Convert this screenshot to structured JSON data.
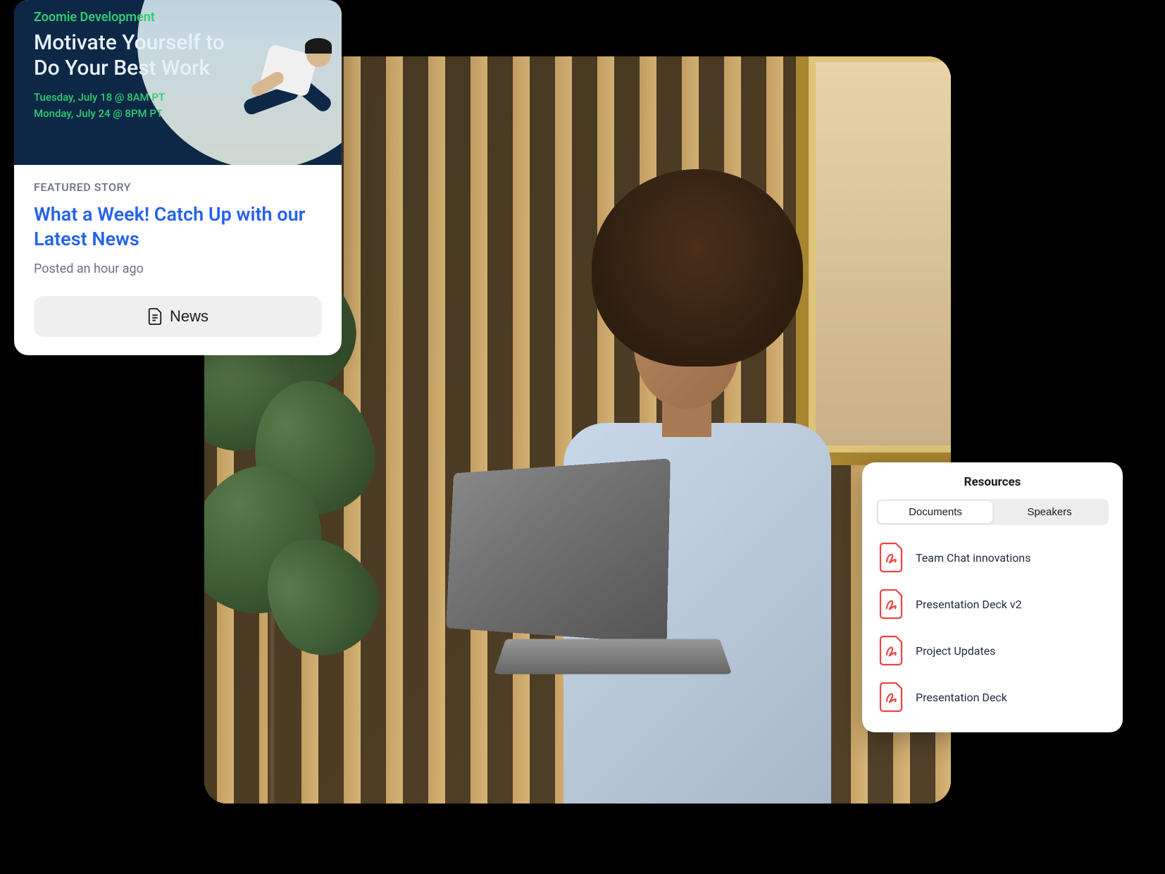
{
  "storyCard": {
    "brand": "Zoomie Development",
    "heroTitle": "Motivate Yourself to Do Your Best Work",
    "dates": [
      "Tuesday, July 18 @ 8AM PT",
      "Monday, July 24 @ 8PM PT"
    ],
    "featuredLabel": "FEATURED STORY",
    "headline": "What a Week! Catch Up with our Latest News",
    "posted": "Posted an hour ago",
    "newsButtonLabel": "News"
  },
  "resources": {
    "title": "Resources",
    "tabs": [
      {
        "label": "Documents",
        "active": true
      },
      {
        "label": "Speakers",
        "active": false
      }
    ],
    "items": [
      {
        "name": "Team Chat innovations"
      },
      {
        "name": "Presentation Deck v2"
      },
      {
        "name": "Project Updates"
      },
      {
        "name": "Presentation Deck"
      }
    ]
  }
}
